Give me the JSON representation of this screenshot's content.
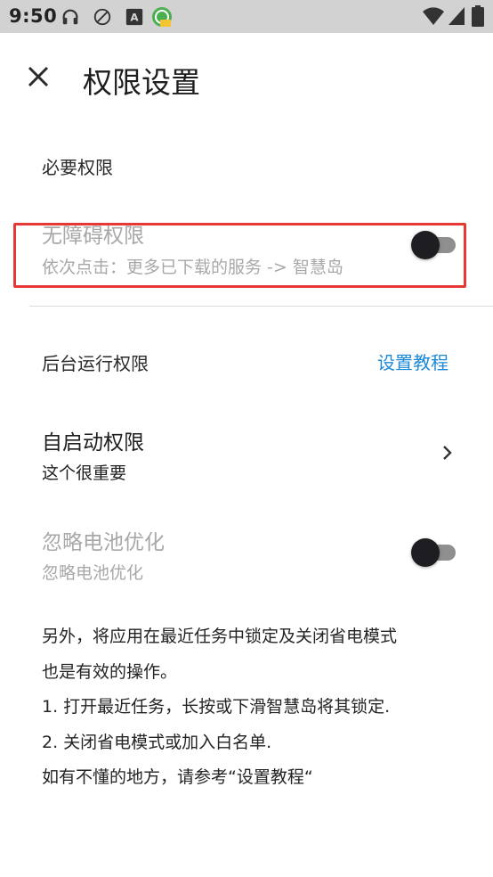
{
  "status_bar": {
    "time": "9:50",
    "icons": [
      "headset-icon",
      "no-location-icon",
      "font-a-icon",
      "app-notification-icon",
      "wifi-icon",
      "signal-icon",
      "battery-icon"
    ]
  },
  "header": {
    "title": "权限设置",
    "close_icon": "close-icon"
  },
  "sections": {
    "required": {
      "label": "必要权限",
      "accessibility": {
        "title": "无障碍权限",
        "subtitle": "依次点击：更多已下载的服务 -> 智慧岛",
        "enabled": false
      }
    },
    "background": {
      "label": "后台运行权限",
      "tutorial_link": "设置教程",
      "autostart": {
        "title": "自启动权限",
        "subtitle": "这个很重要"
      },
      "battery": {
        "title": "忽略电池优化",
        "subtitle": "忽略电池优化",
        "enabled": false
      }
    }
  },
  "note": {
    "lines": [
      "另外，将应用在最近任务中锁定及关闭省电模式",
      "也是有效的操作。",
      "1. 打开最近任务，长按或下滑智慧岛将其锁定.",
      "2. 关闭省电模式或加入白名单.",
      "如有不懂的地方，请参考“设置教程“"
    ]
  },
  "colors": {
    "status_bar_bg": "#d2d2d2",
    "accent_link": "#1e88d9",
    "highlight": "#e53935",
    "disabled_text": "#a8a8a8"
  }
}
